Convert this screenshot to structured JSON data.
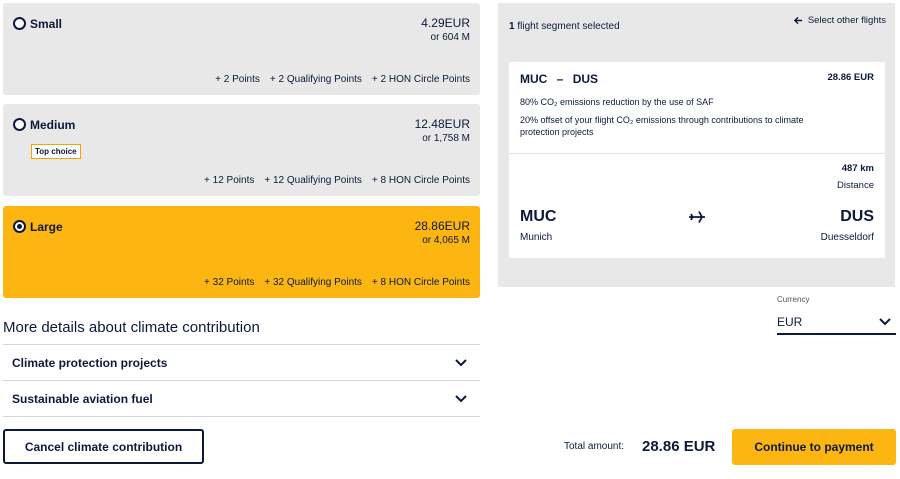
{
  "options": [
    {
      "name": "Small",
      "price": "4.29EUR",
      "miles": "or 604 M",
      "points": [
        "+ 2 Points",
        "+ 2 Qualifying Points",
        "+ 2 HON Circle Points"
      ],
      "selected": false
    },
    {
      "name": "Medium",
      "price": "12.48EUR",
      "miles": "or 1,758 M",
      "badge": "Top choice",
      "points": [
        "+ 12 Points",
        "+ 12 Qualifying Points",
        "+ 8 HON Circle Points"
      ],
      "selected": false
    },
    {
      "name": "Large",
      "price": "28.86EUR",
      "miles": "or 4,065 M",
      "points": [
        "+ 32 Points",
        "+ 32 Qualifying Points",
        "+ 8 HON Circle Points"
      ],
      "selected": true
    }
  ],
  "details": {
    "title": "More details about climate contribution",
    "accordions": [
      "Climate protection projects",
      "Sustainable aviation fuel"
    ]
  },
  "cancel_label": "Cancel climate contribution",
  "segment": {
    "count": "1",
    "count_text": "flight segment selected",
    "select_other": "Select other flights",
    "route_from": "MUC",
    "route_dash": "–",
    "route_to": "DUS",
    "price": "28.86 EUR",
    "saf_line": "80% CO₂ emissions reduction by the use of SAF",
    "offset_line": "20% offset of your flight CO₂ emissions through contributions to climate protection projects",
    "distance": "487 km",
    "distance_label": "Distance",
    "from_code": "MUC",
    "from_city": "Munich",
    "to_code": "DUS",
    "to_city": "Duesseldorf"
  },
  "currency": {
    "label": "Currency",
    "value": "EUR"
  },
  "total": {
    "label": "Total amount:",
    "value": "28.86 EUR"
  },
  "pay_label": "Continue to payment",
  "colors": {
    "accent": "#fdb512",
    "navy": "#0b1a3a",
    "panel": "#e8e8e8"
  }
}
